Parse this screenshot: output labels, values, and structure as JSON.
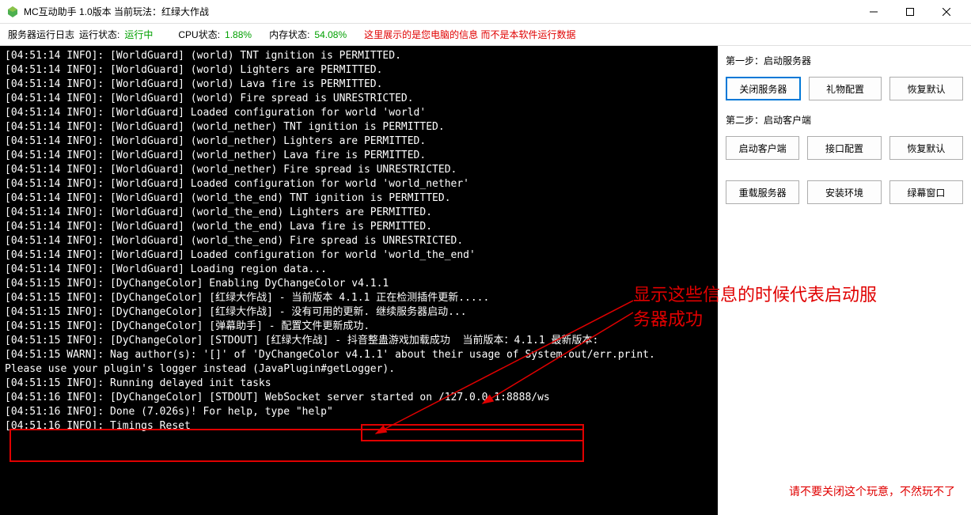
{
  "window": {
    "title": "MC互动助手 1.0版本  当前玩法：红绿大作战"
  },
  "statusbar": {
    "log_label": "服务器运行日志",
    "run_state_label": "运行状态:",
    "run_state_value": "运行中",
    "cpu_label": "CPU状态:",
    "cpu_value": "1.88%",
    "mem_label": "内存状态:",
    "mem_value": "54.08%",
    "notice": "这里展示的是您电脑的信息 而不是本软件运行数据"
  },
  "sidebar": {
    "step1_label": "第一步：启动服务器",
    "step2_label": "第二步：启动客户端",
    "btn_close_server": "关闭服务器",
    "btn_gift_config": "礼物配置",
    "btn_restore1": "恢复默认",
    "btn_start_client": "启动客户端",
    "btn_api_config": "接口配置",
    "btn_restore2": "恢复默认",
    "btn_reload_server": "重载服务器",
    "btn_install_env": "安装环境",
    "btn_green_screen": "绿幕窗口"
  },
  "annotations": {
    "success_msg": "显示这些信息的时候代表启动服务器成功",
    "bottom_warning": "请不要关闭这个玩意，不然玩不了"
  },
  "logs": [
    "[04:51:14 INFO]: [WorldGuard] (world) TNT ignition is PERMITTED.",
    "[04:51:14 INFO]: [WorldGuard] (world) Lighters are PERMITTED.",
    "[04:51:14 INFO]: [WorldGuard] (world) Lava fire is PERMITTED.",
    "[04:51:14 INFO]: [WorldGuard] (world) Fire spread is UNRESTRICTED.",
    "[04:51:14 INFO]: [WorldGuard] Loaded configuration for world 'world'",
    "[04:51:14 INFO]: [WorldGuard] (world_nether) TNT ignition is PERMITTED.",
    "[04:51:14 INFO]: [WorldGuard] (world_nether) Lighters are PERMITTED.",
    "[04:51:14 INFO]: [WorldGuard] (world_nether) Lava fire is PERMITTED.",
    "[04:51:14 INFO]: [WorldGuard] (world_nether) Fire spread is UNRESTRICTED.",
    "[04:51:14 INFO]: [WorldGuard] Loaded configuration for world 'world_nether'",
    "[04:51:14 INFO]: [WorldGuard] (world_the_end) TNT ignition is PERMITTED.",
    "[04:51:14 INFO]: [WorldGuard] (world_the_end) Lighters are PERMITTED.",
    "[04:51:14 INFO]: [WorldGuard] (world_the_end) Lava fire is PERMITTED.",
    "[04:51:14 INFO]: [WorldGuard] (world_the_end) Fire spread is UNRESTRICTED.",
    "[04:51:14 INFO]: [WorldGuard] Loaded configuration for world 'world_the_end'",
    "[04:51:14 INFO]: [WorldGuard] Loading region data...",
    "[04:51:15 INFO]: [DyChangeColor] Enabling DyChangeColor v4.1.1",
    "[04:51:15 INFO]: [DyChangeColor] [红绿大作战] - 当前版本 4.1.1 正在检测插件更新.....",
    "[04:51:15 INFO]: [DyChangeColor] [红绿大作战] - 没有可用的更新. 继续服务器启动...",
    "[04:51:15 INFO]: [DyChangeColor] [弹幕助手] - 配置文件更新成功.",
    "[04:51:15 INFO]: [DyChangeColor] [STDOUT] [红绿大作战] - 抖音整蛊游戏加载成功  当前版本：4.1.1 最新版本:",
    "[04:51:15 WARN]: Nag author(s): '[]' of 'DyChangeColor v4.1.1' about their usage of System.out/err.print.",
    "Please use your plugin's logger instead (JavaPlugin#getLogger).",
    "[04:51:15 INFO]: Running delayed init tasks",
    "[04:51:16 INFO]: [DyChangeColor] [STDOUT] WebSocket server started on /127.0.0.1:8888/ws",
    "[04:51:16 INFO]: Done (7.026s)! For help, type \"help\"",
    "[04:51:16 INFO]: Timings Reset"
  ]
}
